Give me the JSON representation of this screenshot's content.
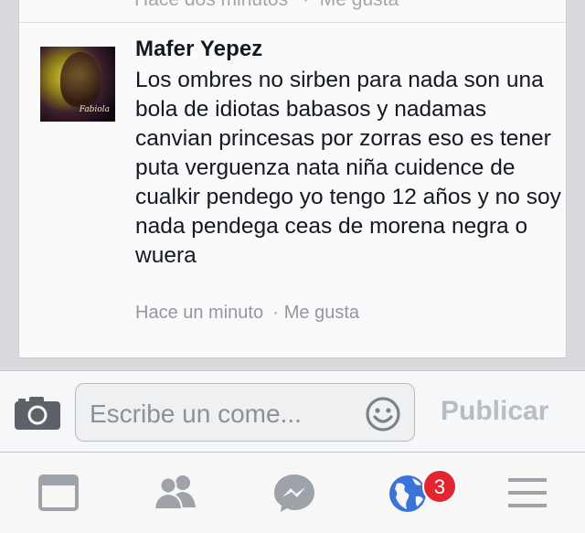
{
  "previous_comment": {
    "time": "Hace dos minutos",
    "separator": "·",
    "like": "Me gusta"
  },
  "comment": {
    "author": "Mafer Yepez",
    "text": "Los ombres no sirben para nada son una bola de idiotas babasos y nadamas canvian princesas por zorras eso es tener puta verguenza nata niña cuidence de cualkir pendego yo tengo 12 años y no soy nada pendega ceas de morena negra o wuera",
    "time": "Hace un minuto",
    "separator": "·",
    "like": "Me gusta",
    "avatar_watermark": "Fabiola"
  },
  "composer": {
    "placeholder": "Escribe un come...",
    "publish_label": "Publicar",
    "camera_icon": "camera-icon",
    "emoji_icon": "smiley-icon"
  },
  "nav": {
    "items": [
      "news-feed-icon",
      "friends-icon",
      "messenger-icon",
      "notifications-globe-icon",
      "menu-icon"
    ],
    "notifications_count": "3"
  },
  "colors": {
    "accent_blue": "#3b73d8",
    "badge_red": "#e3252f",
    "icon_gray": "#9ea2a9"
  }
}
